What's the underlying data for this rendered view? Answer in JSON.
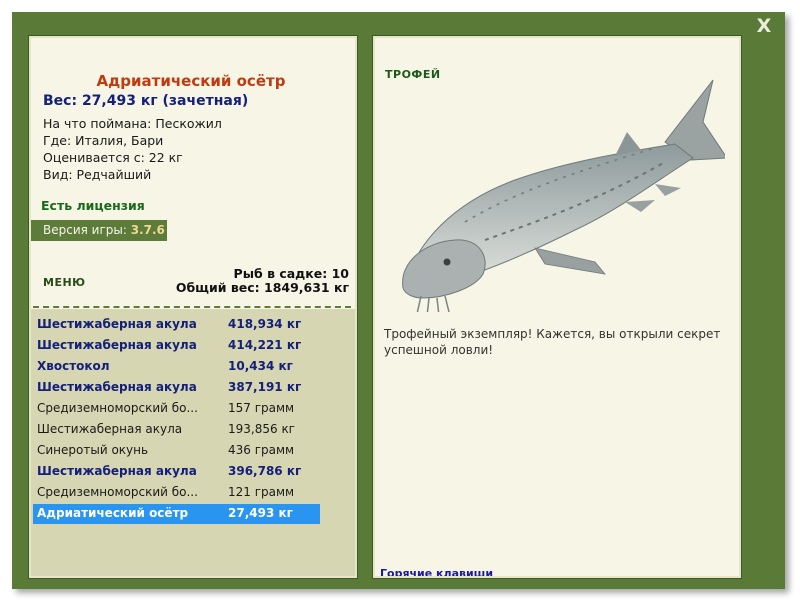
{
  "window": {
    "close_label": "X"
  },
  "fish_info": {
    "name": "Адриатический осётр",
    "weight_line": "Вес: 27,493 кг (зачетная)",
    "caught_on": "На что поймана: Пескожил",
    "location": "Где: Италия, Бари",
    "valued_from": "Оценивается с: 22 кг",
    "rarity": "Вид: Редчайший"
  },
  "license": "Есть лицензия",
  "version": {
    "label": "Версия игры: ",
    "value": "3.7.6"
  },
  "menu_label": "МЕНЮ",
  "cage": {
    "count_line": "Рыб в садке: 10",
    "total_line": "Общий вес: 1849,631 кг"
  },
  "catch_list": [
    {
      "name": "Шестижаберная акула",
      "weight": "418,934 кг",
      "style": "bold"
    },
    {
      "name": "Шестижаберная акула",
      "weight": "414,221 кг",
      "style": "bold"
    },
    {
      "name": "Хвостокол",
      "weight": "10,434 кг",
      "style": "bold"
    },
    {
      "name": "Шестижаберная акула",
      "weight": "387,191 кг",
      "style": "bold"
    },
    {
      "name": "Средиземноморский бо...",
      "weight": "157 грамм",
      "style": "normal"
    },
    {
      "name": "Шестижаберная акула",
      "weight": "193,856 кг",
      "style": "normal"
    },
    {
      "name": "Синеротый окунь",
      "weight": "436 грамм",
      "style": "normal"
    },
    {
      "name": "Шестижаберная акула",
      "weight": "396,786 кг",
      "style": "bold"
    },
    {
      "name": "Средиземноморский бо...",
      "weight": "121 грамм",
      "style": "normal"
    },
    {
      "name": "Адриатический осётр",
      "weight": "27,493 кг",
      "style": "selected"
    }
  ],
  "trophy": {
    "label": "ТРОФЕЙ",
    "description": "Трофейный экземпляр! Кажется, вы открыли секрет успешной ловли!",
    "hotkeys_link": "Горячие клавиши"
  },
  "colors": {
    "frame": "#5a7a38",
    "panel": "#f6f5e6",
    "list_bg": "#d7d6b2",
    "selected_row": "#2a95f0",
    "fish_name": "#c03a10",
    "bold_row_text": "#14207a"
  },
  "icons": {
    "close": "close-icon",
    "fish": "sturgeon-fish-image"
  }
}
